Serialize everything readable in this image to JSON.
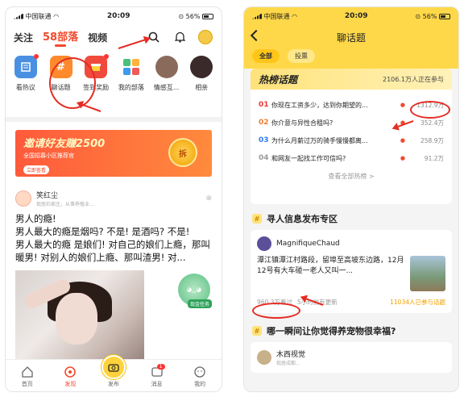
{
  "left": {
    "status": {
      "carrier": "中国联通",
      "time": "20:09",
      "battery": "56%"
    },
    "nav": {
      "tabs": [
        "关注",
        "58部落",
        "视频"
      ],
      "active_tab": "58部落"
    },
    "shortcuts": [
      "看热议",
      "聊话题",
      "签到奖励",
      "我的部落",
      "情感互...",
      "相亲"
    ],
    "shortcut_icons": [
      "hot-discuss-icon",
      "chat-topic-icon",
      "signin-reward-icon",
      "my-tribe-icon",
      "emotion-avatar-icon",
      "dating-icon"
    ],
    "banner": {
      "title": "邀请好友赚2500",
      "subtitle": "全国招募小区推荐官",
      "cta": "立即查看",
      "coin_text": "拆"
    },
    "post": {
      "author": "笑红尘",
      "meta": "现居石家庄，从事养殖业...",
      "lines": [
        "男人的瘾!",
        "男人最大的瘾是烟吗? 不是! 是酒吗? 不是!",
        "男人最大的瘾 是娘们! 对自己的娘们上瘾，那叫暖男! 对别人的娘们上瘾、那叫渣男! 对..."
      ]
    },
    "fab": {
      "label": "现金任务"
    },
    "bottom": {
      "items": [
        "首页",
        "发现",
        "发布",
        "消息",
        "我的"
      ],
      "active": "发现",
      "message_badge": "1"
    }
  },
  "right": {
    "status": {
      "carrier": "中国联通",
      "time": "20:09",
      "battery": "56%"
    },
    "title": "聊话题",
    "filters": [
      "全部",
      "投票"
    ],
    "hot": {
      "title": "热榜话题",
      "subtitle": "2106.1万人正在参与",
      "rows": [
        {
          "rank": "01",
          "text": "你现在工资多少，达到你期望的...",
          "count": "1312.9万"
        },
        {
          "rank": "02",
          "text": "你介意与异性合租吗?",
          "count": "352.4万"
        },
        {
          "rank": "03",
          "text": "为什么月薪过万的骑手慢慢都离...",
          "count": "258.9万"
        },
        {
          "rank": "04",
          "text": "和网友一起找工作可信吗?",
          "count": "91.2万"
        }
      ],
      "more": "查看全部热榜 >"
    },
    "section1": {
      "title": "寻人信息发布专区",
      "user": "MagnifiqueChaud",
      "text": "潭江镇潭江村路段，留埠至高坡东边路，12月12号有大车碰一老人又叫一...",
      "views": "960.3万看过",
      "time": "5小时前有更新",
      "participants": "11034人已参与话题"
    },
    "section2": {
      "title": "哪一瞬间让你觉得养宠物很幸福?",
      "user": "木西视觉",
      "meta": "现居成都..."
    }
  }
}
